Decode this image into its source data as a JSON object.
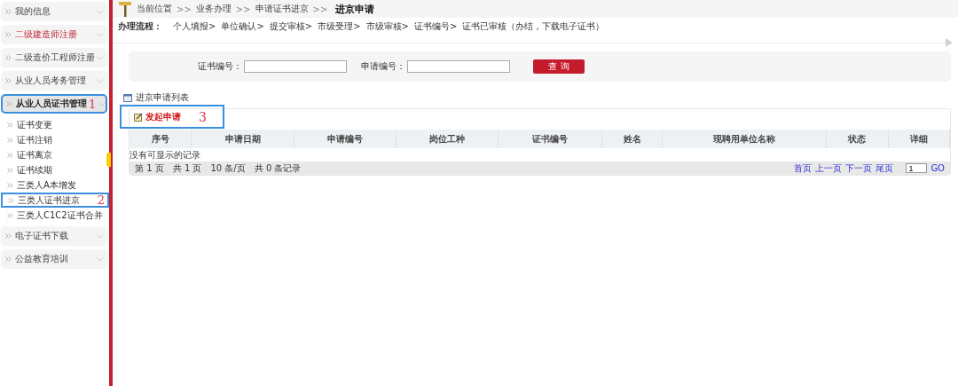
{
  "sidebar": {
    "items": [
      {
        "label": "我的信息",
        "expanded": false,
        "highlighted": false
      },
      {
        "label": "二级建造师注册",
        "expanded": false,
        "highlighted": true
      },
      {
        "label": "二级造价工程师注册",
        "expanded": false,
        "highlighted": false
      },
      {
        "label": "从业人员考务管理",
        "expanded": false,
        "highlighted": false
      },
      {
        "label": "从业人员证书管理",
        "expanded": true,
        "highlighted": false,
        "callout": "1",
        "children": [
          {
            "label": "证书变更"
          },
          {
            "label": "证书注销"
          },
          {
            "label": "证书离京"
          },
          {
            "label": "证书续期"
          },
          {
            "label": "三类人A本增发"
          },
          {
            "label": "三类人证书进京",
            "callout": "2"
          },
          {
            "label": "三类人C1C2证书合并"
          }
        ]
      },
      {
        "label": "电子证书下载",
        "expanded": false,
        "highlighted": false
      },
      {
        "label": "公益教育培训",
        "expanded": false,
        "highlighted": false
      }
    ]
  },
  "breadcrumb": {
    "items": [
      "当前位置",
      ">>",
      "业务办理",
      ">>",
      "申请证书进京",
      ">>"
    ],
    "current": "进京申请"
  },
  "process": {
    "label": "办理流程：",
    "steps": [
      "个人填报>",
      "单位确认>",
      "提交审核>",
      "市级受理>",
      "市级审核>",
      "证书编号>",
      "证书已审核（办结，下载电子证书）"
    ]
  },
  "search": {
    "fields": [
      {
        "label": "证书编号："
      },
      {
        "label": "申请编号："
      }
    ],
    "button": "查 询"
  },
  "list": {
    "title": "进京申请列表",
    "new_button": "发起申请",
    "callout": "3",
    "table": {
      "columns": [
        "序号",
        "申请日期",
        "申请编号",
        "岗位工种",
        "证书编号",
        "姓名",
        "现聘用单位名称",
        "状态",
        "详细"
      ],
      "empty": "没有可显示的记录"
    },
    "pager": {
      "info": [
        "第 1 页",
        "共 1 页",
        "10 条/页",
        "共 0 条记录"
      ],
      "links": [
        "首页",
        "上一页",
        "下一页",
        "尾页"
      ],
      "page_value": "1",
      "go": "GO"
    }
  }
}
